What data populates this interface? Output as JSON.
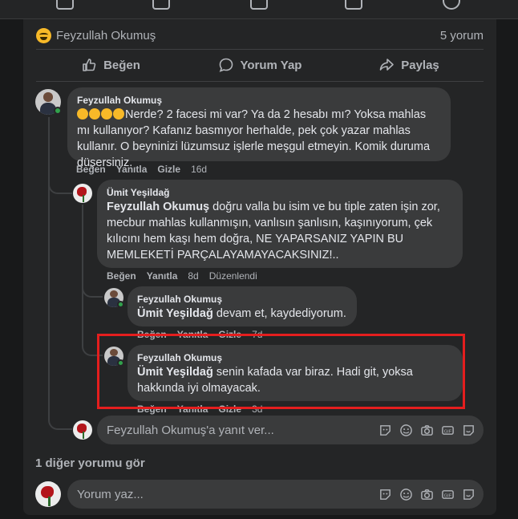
{
  "post": {
    "reaction_name": "Feyzullah Okumuş",
    "comment_count": "5 yorum",
    "actions": {
      "like": "Beğen",
      "comment": "Yorum Yap",
      "share": "Paylaş"
    }
  },
  "comments": [
    {
      "author": "Feyzullah Okumuş",
      "text_after_emoji": "Nerde? 2 facesi mi var? Ya da 2 hesabı mı? Yoksa mahlas mı kullanıyor? Kafanız basmıyor herhalde, pek çok yazar mahlas kullanır. O beyninizi lüzumsuz işlerle meşgul etmeyin. Komik duruma düşersiniz.",
      "like": "Beğen",
      "reply": "Yanıtla",
      "hide": "Gizle",
      "time": "16d"
    },
    {
      "author": "Ümit Yeşildağ",
      "mention": "Feyzullah Okumuş",
      "text": " doğru valla bu isim ve bu tiple zaten işin zor, mecbur mahlas kullanmışın, vanlısın şanlısın, kaşınıyorum, çek kılıcını hem kaşı hem doğra, NE YAPARSANIZ YAPIN BU MEMLEKETİ PARÇALAYAMAYACAKSINIZ!..",
      "like": "Beğen",
      "reply": "Yanıtla",
      "time": "8d",
      "edited": "Düzenlendi"
    },
    {
      "author": "Feyzullah Okumuş",
      "mention": "Ümit Yeşildağ",
      "text": " devam et, kaydediyorum.",
      "like": "Beğen",
      "reply": "Yanıtla",
      "hide": "Gizle",
      "time": "7d"
    },
    {
      "author": "Feyzullah Okumuş",
      "mention": "Ümit Yeşildağ",
      "text": " senin kafada var biraz. Hadi git, yoksa hakkında iyi olmayacak.",
      "like": "Beğen",
      "reply": "Yanıtla",
      "hide": "Gizle",
      "time": "3d"
    }
  ],
  "reply_box": {
    "placeholder": "Feyzullah Okumuş'a yanıt ver..."
  },
  "see_more": "1 diğer yorumu gör",
  "comment_box": {
    "placeholder": "Yorum yaz..."
  },
  "composer_icons": [
    "sticker-icon",
    "emoji-icon",
    "camera-icon",
    "gif-icon",
    "avatar-sticker-icon"
  ],
  "colors": {
    "background": "#18191a",
    "card": "#242526",
    "bubble": "#3a3b3c",
    "text": "#e4e6eb",
    "secondary": "#b0b3b8",
    "highlight": "#e41e1e",
    "online": "#31a24c"
  }
}
